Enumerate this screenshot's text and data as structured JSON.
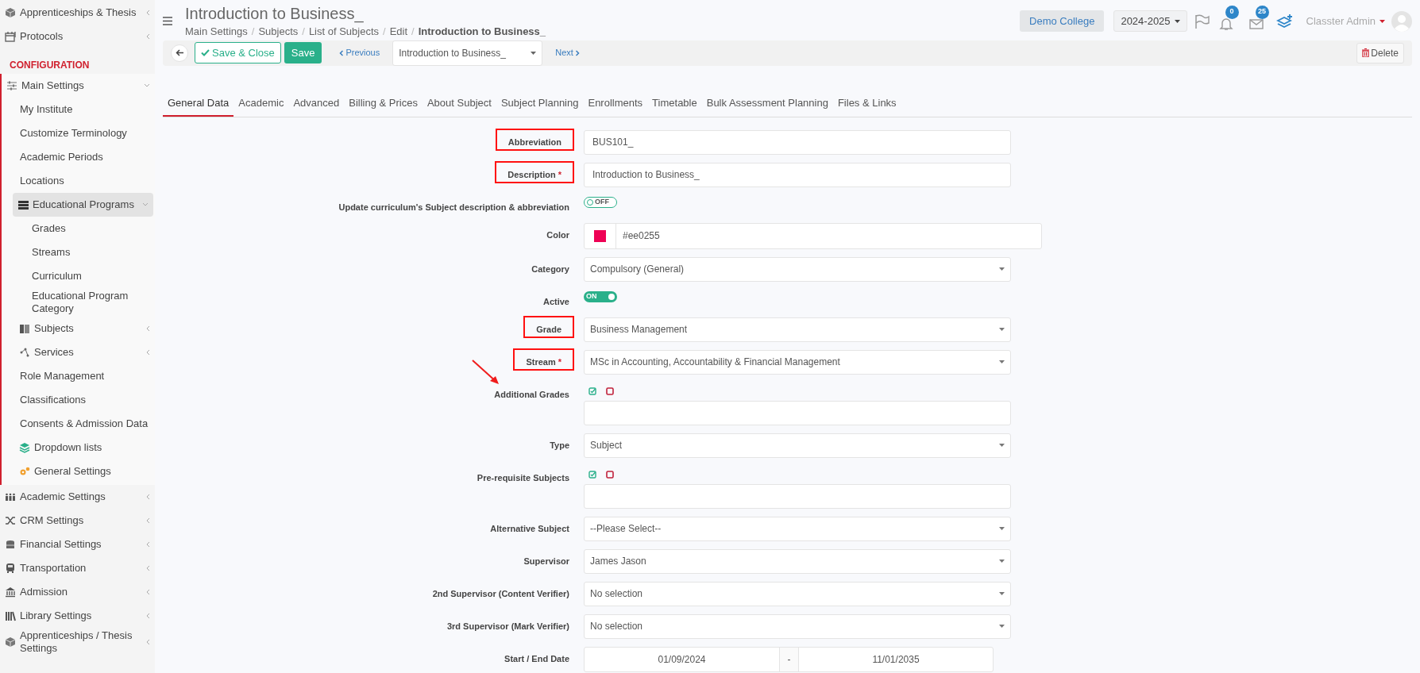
{
  "sidebar": {
    "items": [
      {
        "label": "Apprenticeships & Thesis",
        "kind": "item",
        "icon": true,
        "expanded": false,
        "selected": false
      },
      {
        "label": "Protocols",
        "kind": "item",
        "icon": true,
        "expanded": false,
        "selected": false
      },
      {
        "label": "CONFIGURATION",
        "kind": "heading"
      },
      {
        "label": "Main Settings",
        "kind": "item",
        "icon": true,
        "expanded": true,
        "selected": false,
        "children": [
          {
            "label": "My Institute",
            "kind": "item",
            "icon": false,
            "selected": false
          },
          {
            "label": "Customize Terminology",
            "kind": "item",
            "icon": false,
            "selected": false
          },
          {
            "label": "Academic Periods",
            "kind": "item",
            "icon": false,
            "selected": false
          },
          {
            "label": "Locations",
            "kind": "item",
            "icon": false,
            "selected": false
          },
          {
            "label": "Educational Programs",
            "kind": "item",
            "icon": true,
            "expanded": true,
            "selected": true,
            "children": [
              {
                "label": "Grades",
                "kind": "item",
                "icon": false,
                "selected": false
              },
              {
                "label": "Streams",
                "kind": "item",
                "icon": false,
                "selected": false
              },
              {
                "label": "Curriculum",
                "kind": "item",
                "icon": false,
                "selected": false
              },
              {
                "label": "Educational Program Category",
                "kind": "item",
                "icon": false,
                "selected": false
              }
            ]
          },
          {
            "label": "Subjects",
            "kind": "item",
            "icon": true,
            "expanded": false,
            "selected": false
          },
          {
            "label": "Services",
            "kind": "item",
            "icon": true,
            "expanded": false,
            "selected": false
          },
          {
            "label": "Role Management",
            "kind": "item",
            "icon": false,
            "selected": false
          },
          {
            "label": "Classifications",
            "kind": "item",
            "icon": false,
            "selected": false
          },
          {
            "label": "Consents & Admission Data",
            "kind": "item",
            "icon": false,
            "selected": false
          },
          {
            "label": "Dropdown lists",
            "kind": "item",
            "icon": true,
            "selected": false
          },
          {
            "label": "General Settings",
            "kind": "item",
            "icon": true,
            "selected": false
          }
        ]
      },
      {
        "label": "Academic Settings",
        "kind": "item",
        "icon": true,
        "expanded": false,
        "selected": false
      },
      {
        "label": "CRM Settings",
        "kind": "item",
        "icon": true,
        "expanded": false,
        "selected": false
      },
      {
        "label": "Financial Settings",
        "kind": "item",
        "icon": true,
        "expanded": false,
        "selected": false
      },
      {
        "label": "Transportation",
        "kind": "item",
        "icon": true,
        "expanded": false,
        "selected": false
      },
      {
        "label": "Admission",
        "kind": "item",
        "icon": true,
        "expanded": false,
        "selected": false
      },
      {
        "label": "Library Settings",
        "kind": "item",
        "icon": true,
        "expanded": false,
        "selected": false
      },
      {
        "label": "Apprenticeships / Thesis Settings",
        "kind": "item",
        "icon": true,
        "expanded": false,
        "selected": false
      }
    ]
  },
  "header": {
    "title": "Introduction to Business_",
    "breadcrumb_separator": "/",
    "breadcrumbs": [
      "Main Settings",
      "Subjects",
      "List of Subjects",
      "Edit",
      "Introduction to Business_"
    ],
    "institution": "Demo College",
    "year": "2024-2025",
    "notifications": "0",
    "messages": "25",
    "user": "Classter Admin"
  },
  "toolbar": {
    "save_close": "Save & Close",
    "save": "Save",
    "previous": "Previous",
    "record": "Introduction to Business_",
    "next": "Next",
    "delete": "Delete"
  },
  "tabs": [
    {
      "label": "General Data",
      "selected": true
    },
    {
      "label": "Academic",
      "selected": false
    },
    {
      "label": "Advanced",
      "selected": false
    },
    {
      "label": "Billing & Prices",
      "selected": false
    },
    {
      "label": "About Subject",
      "selected": false
    },
    {
      "label": "Subject Planning",
      "selected": false
    },
    {
      "label": "Enrollments",
      "selected": false
    },
    {
      "label": "Timetable",
      "selected": false
    },
    {
      "label": "Bulk Assessment Planning",
      "selected": false
    },
    {
      "label": "Files & Links",
      "selected": false
    }
  ],
  "annotations": [
    {
      "kind": "arrow"
    }
  ],
  "required_mark": "*",
  "form": [
    {
      "label": "Abbreviation",
      "kind": "text",
      "value": "BUS101_",
      "required": false,
      "highlighted": true
    },
    {
      "label": "Description",
      "kind": "text",
      "value": "Introduction to Business_",
      "required": true,
      "highlighted": true
    },
    {
      "label": "Update curriculum's Subject description & abbreviation",
      "kind": "toggle",
      "on": false,
      "value": "OFF",
      "required": false,
      "highlighted": false
    },
    {
      "label": "Color",
      "kind": "color",
      "value": "#ee0255",
      "color": "#ee0255",
      "required": false,
      "highlighted": false
    },
    {
      "label": "Category",
      "kind": "select",
      "value": "Compulsory (General)",
      "required": false,
      "highlighted": false
    },
    {
      "label": "Active",
      "kind": "toggle",
      "on": true,
      "value": "ON",
      "required": false,
      "highlighted": false
    },
    {
      "label": "Grade",
      "kind": "select",
      "value": "Business Management",
      "required": false,
      "highlighted": true
    },
    {
      "label": "Stream",
      "kind": "select",
      "value": "MSc in Accounting, Accountability & Financial Management",
      "required": true,
      "highlighted": true
    },
    {
      "label": "Additional Grades",
      "kind": "multi",
      "required": false,
      "highlighted": false
    },
    {
      "label": "Type",
      "kind": "select",
      "value": "Subject",
      "required": false,
      "highlighted": false
    },
    {
      "label": "Pre-requisite Subjects",
      "kind": "multi",
      "required": false,
      "highlighted": false
    },
    {
      "label": "Alternative Subject",
      "kind": "select",
      "value": "--Please Select--",
      "required": false,
      "highlighted": false
    },
    {
      "label": "Supervisor",
      "kind": "select",
      "value": "James Jason",
      "required": false,
      "highlighted": false
    },
    {
      "label": "2nd Supervisor (Content Verifier)",
      "kind": "select",
      "value": "No selection",
      "required": false,
      "highlighted": false
    },
    {
      "label": "3rd Supervisor (Mark Verifier)",
      "kind": "select",
      "value": "No selection",
      "required": false,
      "highlighted": false
    },
    {
      "label": "Start / End Date",
      "kind": "daterange",
      "start": "01/09/2024",
      "separator": "-",
      "end": "11/01/2035",
      "required": false,
      "highlighted": false
    }
  ]
}
